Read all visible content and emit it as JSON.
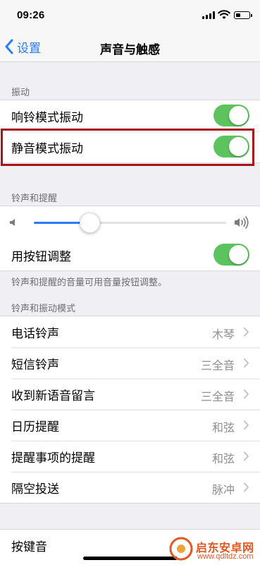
{
  "status_bar": {
    "time": "09:26"
  },
  "nav": {
    "back_label": "设置",
    "title": "声音与触感"
  },
  "vibration": {
    "header": "振动",
    "items": [
      {
        "label": "响铃模式振动",
        "on": true
      },
      {
        "label": "静音模式振动",
        "on": true
      }
    ]
  },
  "ringer": {
    "header": "铃声和提醒",
    "volume_level": 0.29,
    "change_with_buttons": {
      "label": "用按钮调整",
      "on": true
    },
    "footnote": "铃声和提醒的音量可用音量按钮调整。"
  },
  "patterns": {
    "header": "铃声和振动模式",
    "items": [
      {
        "label": "电话铃声",
        "value": "木琴"
      },
      {
        "label": "短信铃声",
        "value": "三全音"
      },
      {
        "label": "收到新语音留言",
        "value": "三全音"
      },
      {
        "label": "日历提醒",
        "value": "和弦"
      },
      {
        "label": "提醒事项的提醒",
        "value": "和弦"
      },
      {
        "label": "隔空投送",
        "value": "脉冲"
      }
    ]
  },
  "keyboard": {
    "label": "按键音"
  },
  "watermark": {
    "title": "启东安卓网",
    "url": "www.qdltdz.com"
  },
  "colors": {
    "accent": "#2a7bf6",
    "toggle_on": "#5cc35e",
    "highlight": "#a8131a"
  },
  "icons": [
    "back-chevron-icon",
    "speaker-low-icon",
    "speaker-high-icon",
    "chevron-right-icon",
    "wifi-icon",
    "battery-icon",
    "signal-icon"
  ]
}
